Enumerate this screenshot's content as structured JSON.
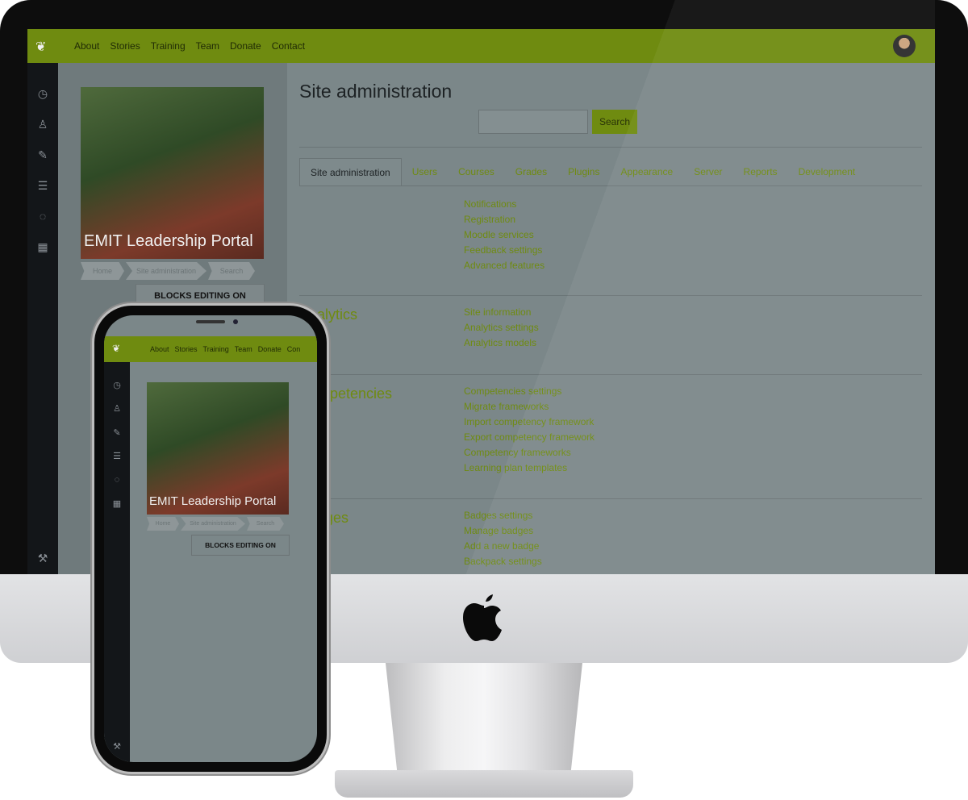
{
  "desktop": {
    "nav": [
      "About",
      "Stories",
      "Training",
      "Team",
      "Donate",
      "Contact"
    ],
    "photo_title": "EMIT Leadership Portal",
    "breadcrumbs": [
      "Home",
      "Site administration",
      "Search"
    ],
    "blocks_button": "BLOCKS EDITING ON",
    "page_title": "Site administration",
    "search_button": "Search",
    "search_value": "",
    "tabs": [
      "Site administration",
      "Users",
      "Courses",
      "Grades",
      "Plugins",
      "Appearance",
      "Server",
      "Reports",
      "Development"
    ],
    "sections": [
      {
        "title": "",
        "links": [
          "Notifications",
          "Registration",
          "Moodle services",
          "Feedback settings",
          "Advanced features"
        ]
      },
      {
        "title": "Analytics",
        "links": [
          "Site information",
          "Analytics settings",
          "Analytics models"
        ]
      },
      {
        "title": "Competencies",
        "links": [
          "Competencies settings",
          "Migrate frameworks",
          "Import competency framework",
          "Export competency framework",
          "Competency frameworks",
          "Learning plan templates"
        ]
      },
      {
        "title": "Badges",
        "links": [
          "Badges settings",
          "Manage badges",
          "Add a new badge",
          "Backpack settings"
        ]
      }
    ]
  },
  "phone": {
    "nav": [
      "About",
      "Stories",
      "Training",
      "Team",
      "Donate",
      "Con"
    ],
    "photo_title": "EMIT Leadership Portal",
    "breadcrumbs": [
      "Home",
      "Site administration",
      "Search"
    ],
    "blocks_button": "BLOCKS EDITING ON"
  },
  "icons": {
    "brand": "feather-icon",
    "sidebar": [
      "dashboard-icon",
      "user-icon",
      "edit-icon",
      "list-icon",
      "chat-icon",
      "calendar-icon",
      "wrench-icon"
    ],
    "device_logo": "apple-logo-icon"
  },
  "colors": {
    "accent": "#6f8b10",
    "sidebar": "#131619",
    "overlay": "#7b8789"
  }
}
